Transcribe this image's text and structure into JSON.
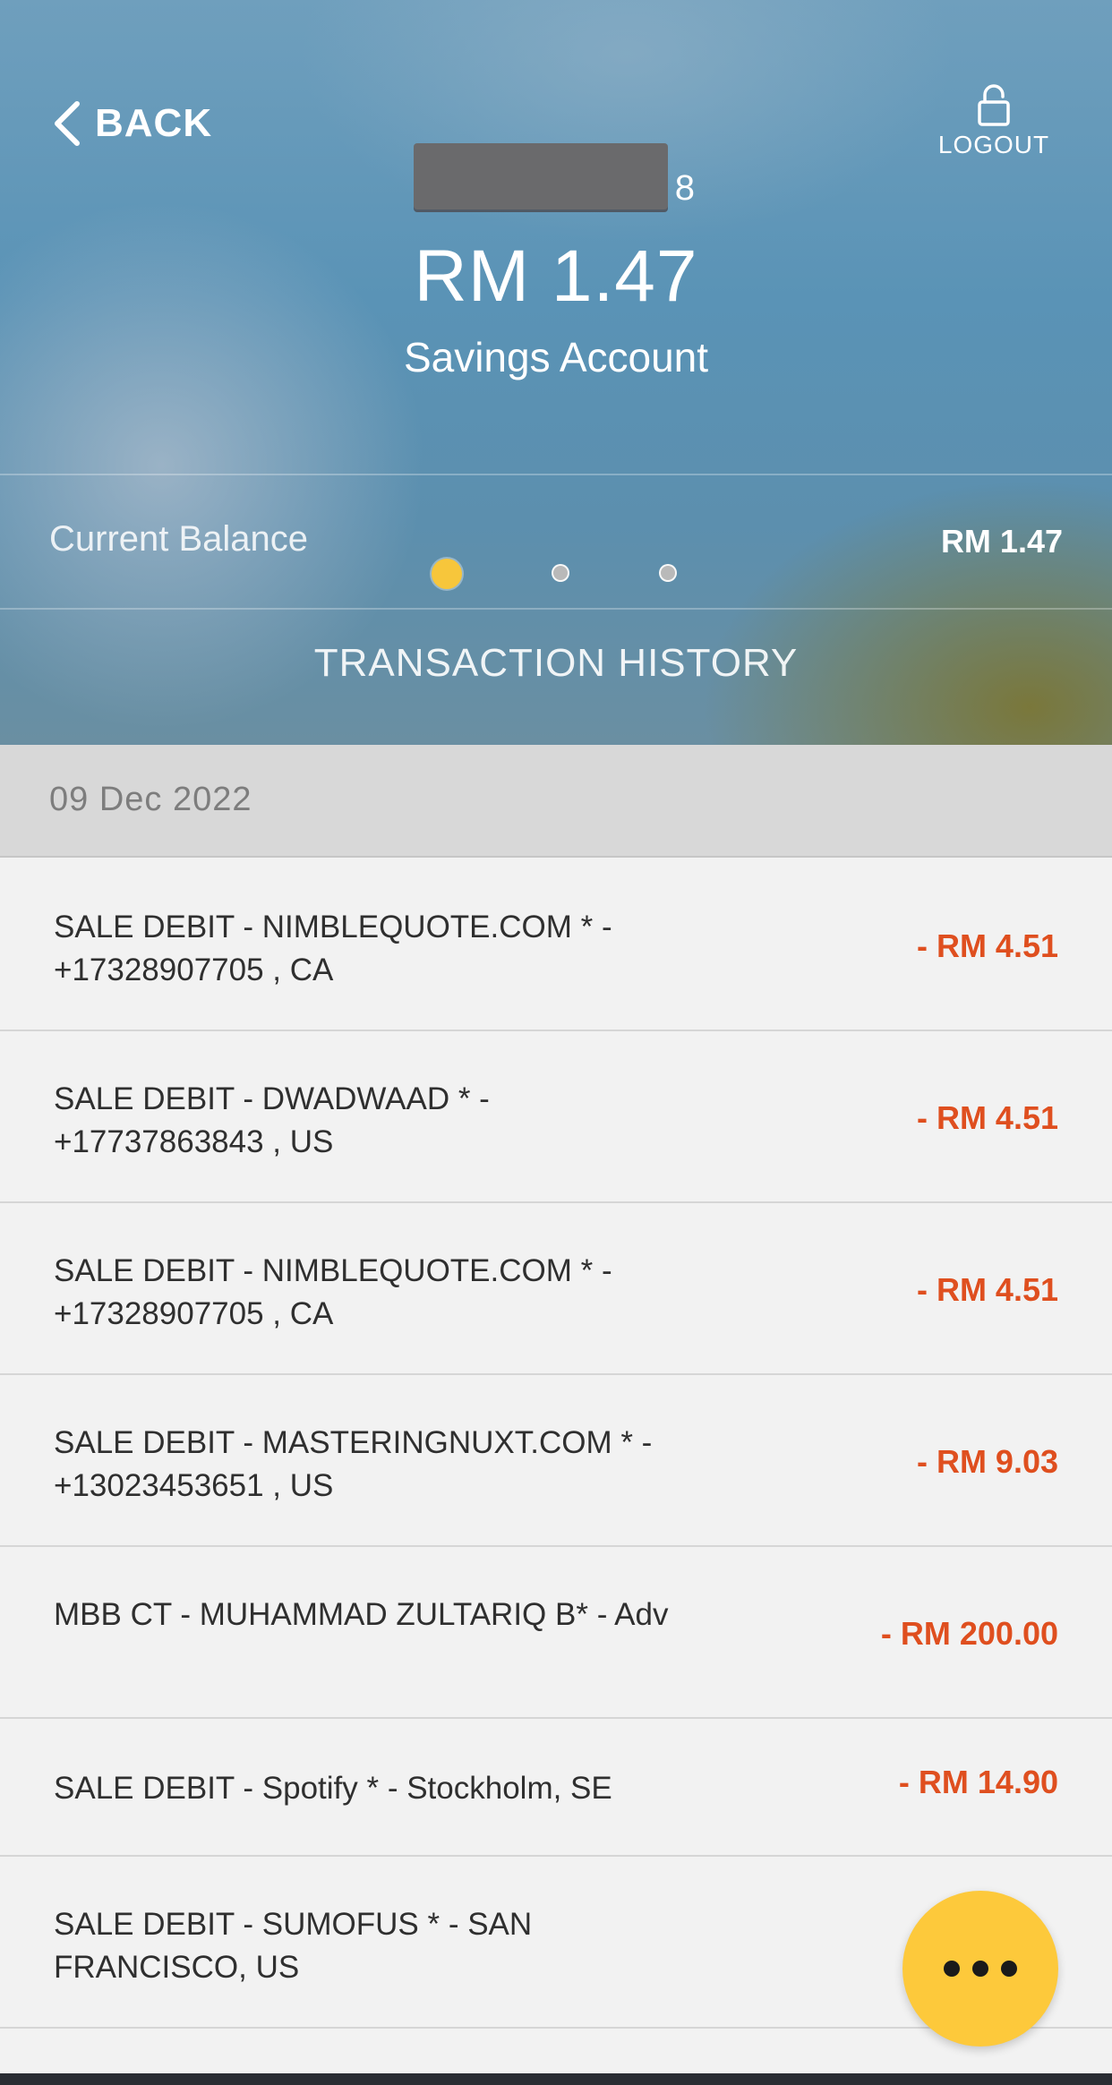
{
  "header": {
    "back_label": "BACK",
    "logout_label": "LOGOUT",
    "account_number_visible_suffix": "8",
    "balance": "RM 1.47",
    "account_type": "Savings Account",
    "current_balance_label": "Current Balance",
    "current_balance_value": "RM 1.47",
    "section_title": "TRANSACTION HISTORY",
    "pager": {
      "pages": 3,
      "active_index": 0,
      "active_color": "#f7c63b"
    }
  },
  "date_group": "09 Dec 2022",
  "transactions": [
    {
      "description": "SALE DEBIT - NIMBLEQUOTE.COM * - +17328907705 , CA",
      "amount": "- RM 4.51"
    },
    {
      "description": "SALE DEBIT - DWADWAAD * - +17737863843 , US",
      "amount": "- RM 4.51"
    },
    {
      "description": "SALE DEBIT - NIMBLEQUOTE.COM * - +17328907705 , CA",
      "amount": "- RM 4.51"
    },
    {
      "description": "SALE DEBIT - MASTERINGNUXT.COM * - +13023453651 , US",
      "amount": "- RM 9.03"
    },
    {
      "description": "MBB CT - MUHAMMAD ZULTARIQ B* - Adv",
      "amount": "- RM 200.00"
    },
    {
      "description": "SALE DEBIT - Spotify * - Stockholm, SE",
      "amount": "- RM 14.90"
    },
    {
      "description": "SALE DEBIT - SUMOFUS * - SAN FRANCISCO, US",
      "amount": ""
    }
  ],
  "colors": {
    "debit_amount": "#df4f1f",
    "fab": "#fdc93b"
  },
  "icons": {
    "back": "chevron-left-icon",
    "logout": "unlock-icon",
    "fab": "more-horizontal-icon"
  }
}
